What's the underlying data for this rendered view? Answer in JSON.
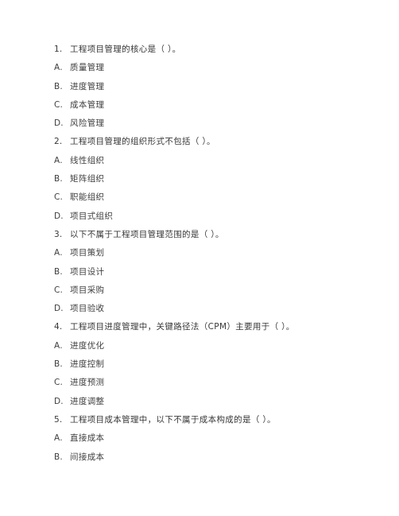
{
  "page": {
    "background_color": "#ffffff",
    "text_color": "#3c3c3c",
    "document_type": "multiple-choice-exam",
    "language": "zh-CN"
  },
  "lines": [
    {
      "kind": "question",
      "marker": "1.",
      "text": "工程项目管理的核心是（ ）。"
    },
    {
      "kind": "option",
      "marker": "A.",
      "text": "质量管理"
    },
    {
      "kind": "option",
      "marker": "B.",
      "text": "进度管理"
    },
    {
      "kind": "option",
      "marker": "C.",
      "text": "成本管理"
    },
    {
      "kind": "option",
      "marker": "D.",
      "text": "风险管理"
    },
    {
      "kind": "question",
      "marker": "2.",
      "text": "工程项目管理的组织形式不包括（ ）。"
    },
    {
      "kind": "option",
      "marker": "A.",
      "text": "线性组织"
    },
    {
      "kind": "option",
      "marker": "B.",
      "text": "矩阵组织"
    },
    {
      "kind": "option",
      "marker": "C.",
      "text": "职能组织"
    },
    {
      "kind": "option",
      "marker": "D.",
      "text": "项目式组织"
    },
    {
      "kind": "question",
      "marker": "3.",
      "text": "以下不属于工程项目管理范围的是（ ）。"
    },
    {
      "kind": "option",
      "marker": "A.",
      "text": "项目策划"
    },
    {
      "kind": "option",
      "marker": "B.",
      "text": "项目设计"
    },
    {
      "kind": "option",
      "marker": "C.",
      "text": "项目采购"
    },
    {
      "kind": "option",
      "marker": "D.",
      "text": "项目验收"
    },
    {
      "kind": "question",
      "marker": "4.",
      "text": "工程项目进度管理中，关键路径法（CPM）主要用于（ ）。"
    },
    {
      "kind": "option",
      "marker": "A.",
      "text": "进度优化"
    },
    {
      "kind": "option",
      "marker": "B.",
      "text": "进度控制"
    },
    {
      "kind": "option",
      "marker": "C.",
      "text": "进度预测"
    },
    {
      "kind": "option",
      "marker": "D.",
      "text": "进度调整"
    },
    {
      "kind": "question",
      "marker": "5.",
      "text": "工程项目成本管理中，以下不属于成本构成的是（ ）。"
    },
    {
      "kind": "option",
      "marker": "A.",
      "text": "直接成本"
    },
    {
      "kind": "option",
      "marker": "B.",
      "text": "间接成本"
    }
  ]
}
